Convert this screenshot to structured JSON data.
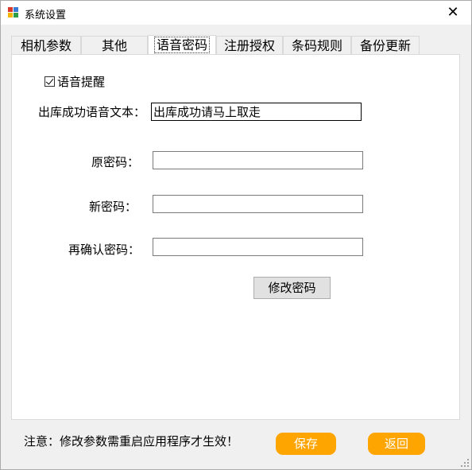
{
  "window": {
    "title": "系统设置",
    "close_glyph": "✕"
  },
  "tabs": [
    {
      "label": "相机参数",
      "active": false
    },
    {
      "label": "其他",
      "active": false
    },
    {
      "label": "语音密码",
      "active": true
    },
    {
      "label": "注册授权",
      "active": false
    },
    {
      "label": "条码规则",
      "active": false
    },
    {
      "label": "备份更新",
      "active": false
    }
  ],
  "voice": {
    "reminder_label": "语音提醒",
    "reminder_checked": true,
    "outbound_text_label": "出库成功语音文本：",
    "outbound_text_value": "出库成功请马上取走"
  },
  "password": {
    "old_label": "原密码：",
    "old_value": "",
    "new_label": "新密码：",
    "new_value": "",
    "confirm_label": "再确认密码：",
    "confirm_value": "",
    "change_button": "修改密码"
  },
  "footer": {
    "notice": "注意：修改参数需重启应用程序才生效！",
    "save_button": "保存",
    "back_button": "返回"
  },
  "colors": {
    "accent": "#ffa500",
    "panel_bg": "#ffffff",
    "window_bg": "#f0f0f0"
  }
}
